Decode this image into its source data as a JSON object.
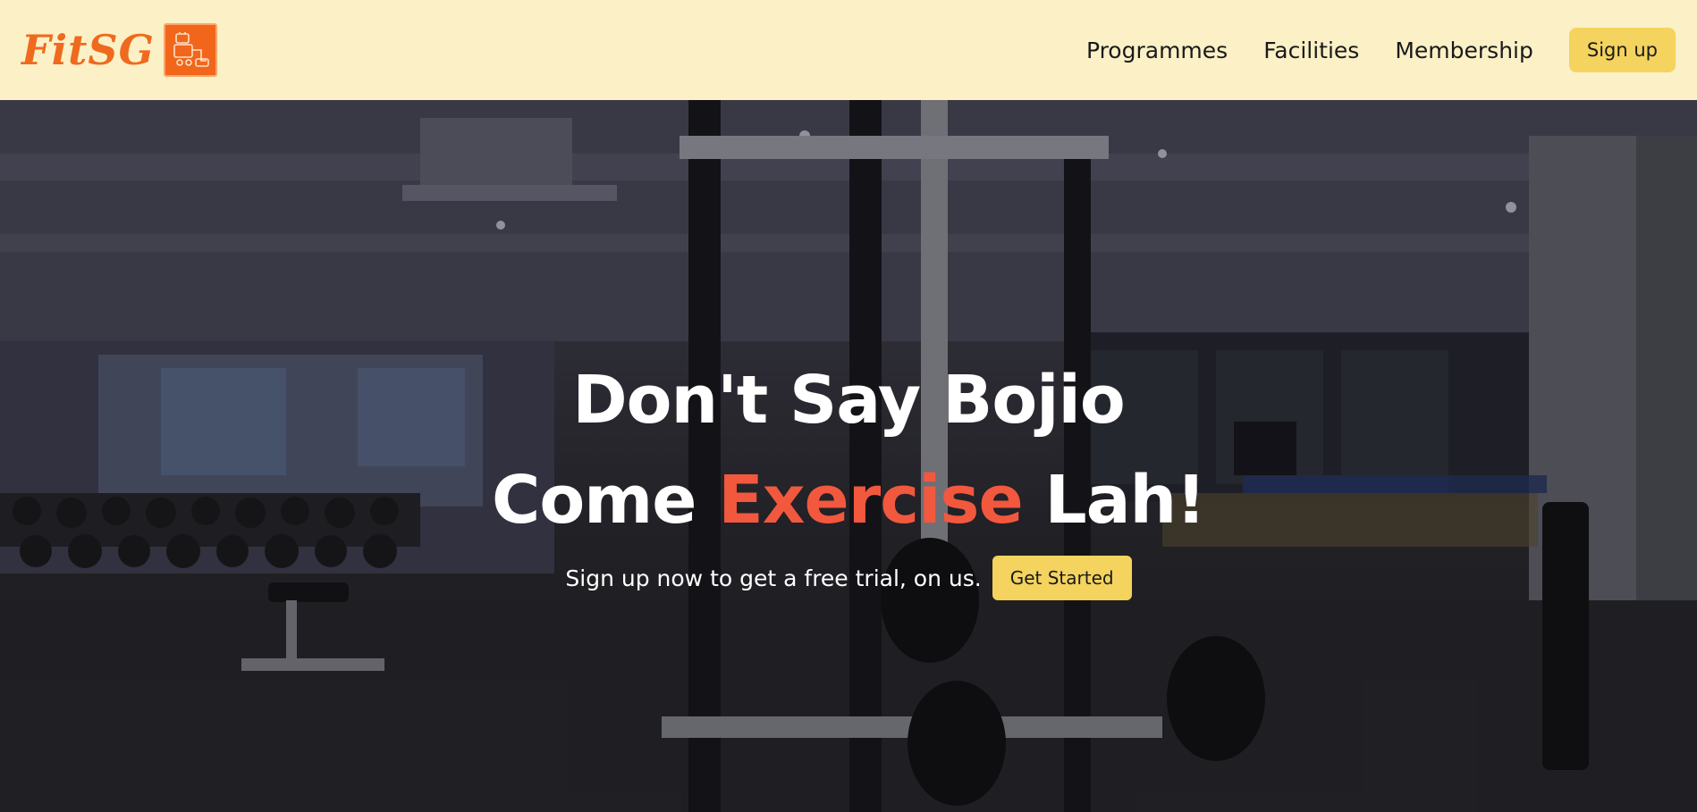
{
  "brand": {
    "name": "FitSG",
    "logo_icon": "fitness-equipment-icon",
    "color": "#ef6a1e"
  },
  "nav": {
    "links": [
      "Programmes",
      "Facilities",
      "Membership"
    ],
    "signup_label": "Sign up"
  },
  "hero": {
    "headline_line1": "Don't Say Bojio",
    "headline_line2_prefix": "Come",
    "headline_line2_accent": "Exercise",
    "headline_line2_suffix": "Lah!",
    "subtext": "Sign up now to get a free trial, on us.",
    "cta_label": "Get Started",
    "background_image": "gym-interior-photo"
  },
  "colors": {
    "navbar_bg": "#fbf0c6",
    "button_bg": "#f4d35e",
    "accent": "#f2583e"
  }
}
